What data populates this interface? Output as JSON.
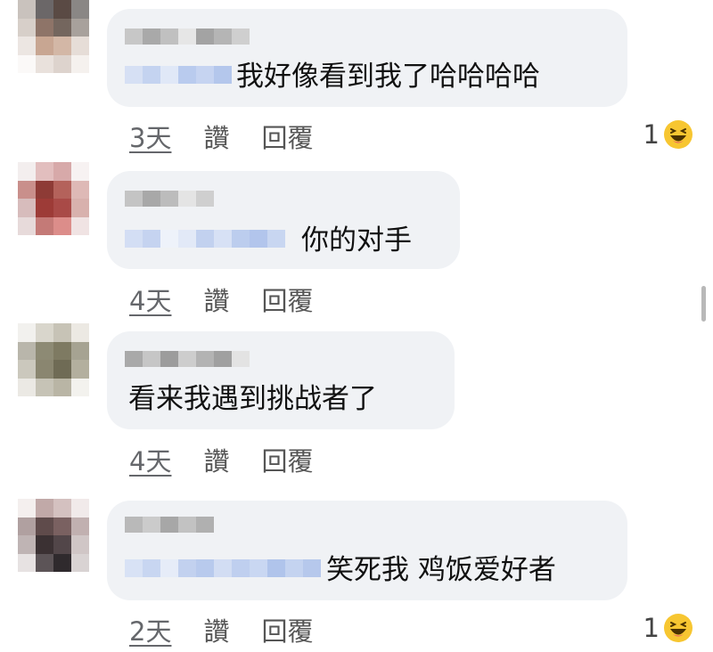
{
  "colors": {
    "bubble_bg": "#f0f2f5",
    "text": "#1c1e21",
    "meta_text": "#65676b",
    "blur_tag": "#c4d3f0",
    "reaction_yellow": "#f7c631"
  },
  "comments": [
    {
      "text": "我好像看到我了哈哈哈哈",
      "time": "3天",
      "like_label": "讚",
      "reply_label": "回覆",
      "reaction_count": "1",
      "reaction_icon": "laugh-icon"
    },
    {
      "text": "你的对手",
      "time": "4天",
      "like_label": "讚",
      "reply_label": "回覆"
    },
    {
      "text": "看来我遇到挑战者了",
      "time": "4天",
      "like_label": "讚",
      "reply_label": "回覆"
    },
    {
      "text": "笑死我 鸡饭爱好者",
      "time": "2天",
      "like_label": "讚",
      "reply_label": "回覆",
      "reaction_count": "1",
      "reaction_icon": "laugh-icon"
    }
  ]
}
